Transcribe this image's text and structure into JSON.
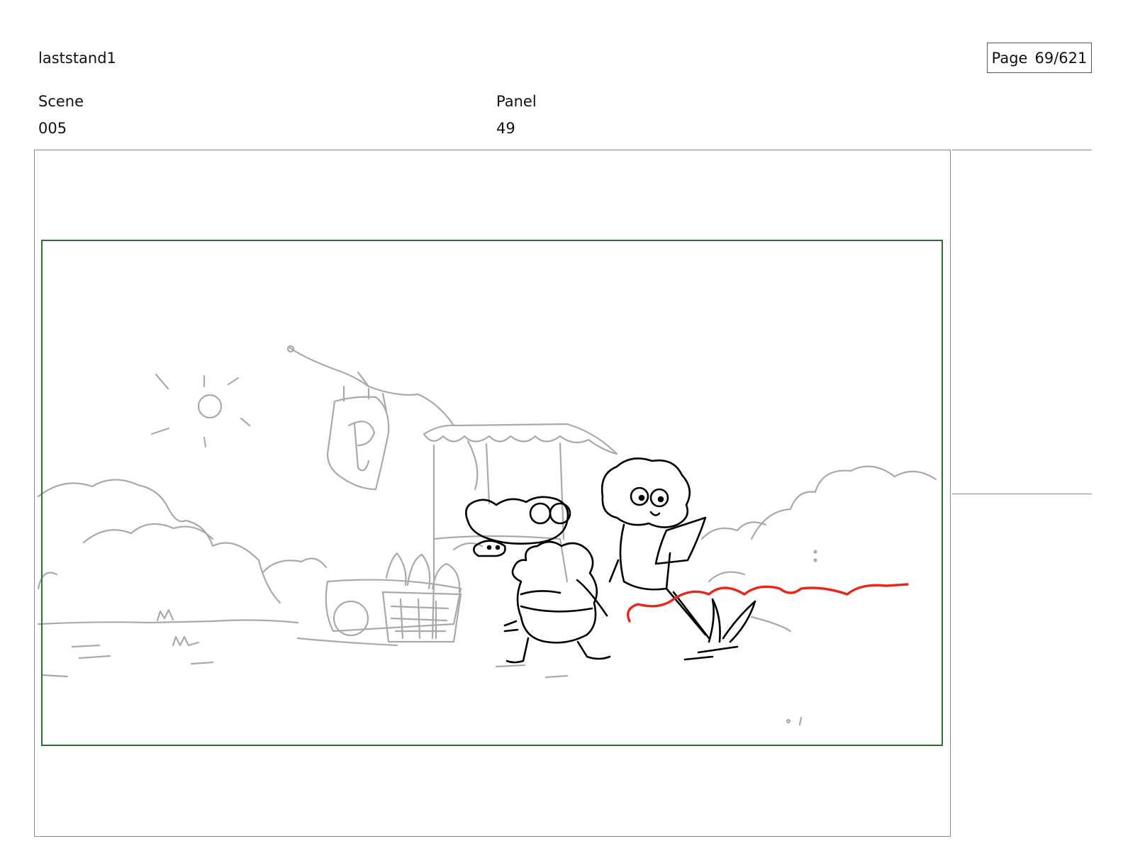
{
  "header": {
    "project_name": "laststand1",
    "page_label": "Page",
    "page_value": "69/621"
  },
  "fields": {
    "scene_label": "Scene",
    "scene_value": "005",
    "panel_label": "Panel",
    "panel_value": "49"
  },
  "colors": {
    "safe_area_border": "#2f6f2f",
    "background_sketch": "#a9a9a9",
    "character_lines": "#000000",
    "action_line": "#e8261b"
  }
}
